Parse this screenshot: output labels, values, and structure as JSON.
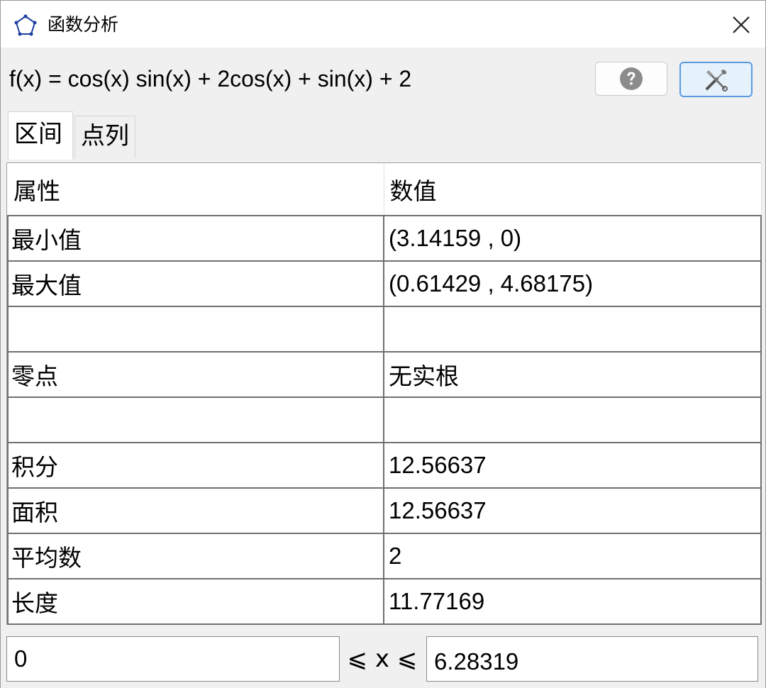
{
  "window": {
    "title": "函数分析",
    "icon": "pentagon-outline-icon",
    "close_icon": "close-icon"
  },
  "function": {
    "expression": "f(x) = cos(x) sin(x) + 2cos(x) + sin(x) + 2"
  },
  "toolbar": {
    "help_icon": "help-icon",
    "tools_icon": "tools-icon"
  },
  "tabs": [
    {
      "label": "区间",
      "active": true
    },
    {
      "label": "点列",
      "active": false
    }
  ],
  "table": {
    "headers": [
      "属性",
      "数值"
    ],
    "rows": [
      {
        "property": "最小值",
        "value": "(3.14159 , 0)"
      },
      {
        "property": "最大值",
        "value": "(0.61429 , 4.68175)"
      },
      {
        "property": "",
        "value": ""
      },
      {
        "property": "零点",
        "value": "无实根"
      },
      {
        "property": "",
        "value": ""
      },
      {
        "property": "积分",
        "value": "12.56637"
      },
      {
        "property": "面积",
        "value": "12.56637"
      },
      {
        "property": "平均数",
        "value": "2"
      },
      {
        "property": "长度",
        "value": "11.77169"
      }
    ]
  },
  "range": {
    "min": "0",
    "label": "⩽ x ⩽",
    "max": "6.28319"
  },
  "colors": {
    "accent": "#5a9be0",
    "tools_bg": "#e5f1fb",
    "window_bg": "#f0f0f0"
  }
}
